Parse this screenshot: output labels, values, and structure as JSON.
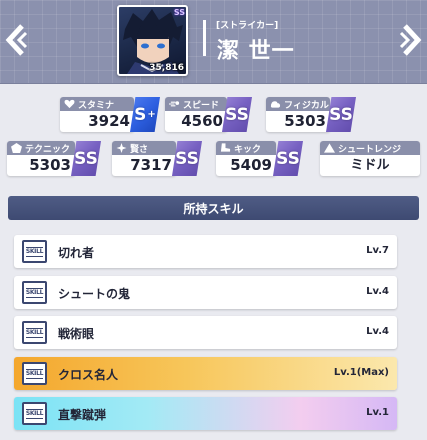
{
  "header": {
    "role": "[ストライカー]",
    "name": "潔 世一",
    "power": "35,816",
    "stamp": "SS"
  },
  "stats": [
    {
      "key": "stamina",
      "label": "スタミナ",
      "value": "3924",
      "rank": "S",
      "rank_plus": "+",
      "icon": "heart-icon"
    },
    {
      "key": "speed",
      "label": "スピード",
      "value": "4560",
      "rank": "SS",
      "icon": "speed-icon"
    },
    {
      "key": "physical",
      "label": "フィジカル",
      "value": "5303",
      "rank": "SS",
      "icon": "muscle-icon"
    },
    {
      "key": "technique",
      "label": "テクニック",
      "value": "5303",
      "rank": "SS",
      "icon": "pentagon-icon"
    },
    {
      "key": "wisdom",
      "label": "賢さ",
      "value": "7317",
      "rank": "SS",
      "icon": "sparkle-icon"
    },
    {
      "key": "kick",
      "label": "キック",
      "value": "5409",
      "rank": "SS",
      "icon": "boot-icon"
    }
  ],
  "shoot_range": {
    "label": "シュートレンジ",
    "value": "ミドル",
    "icon": "triangle-icon"
  },
  "skills_section": {
    "title": "所持スキル",
    "icon_text": "SKILL",
    "items": [
      {
        "name": "切れ者",
        "level": "Lv.7",
        "style": "normal"
      },
      {
        "name": "シュートの鬼",
        "level": "Lv.4",
        "style": "normal"
      },
      {
        "name": "戦術眼",
        "level": "Lv.4",
        "style": "normal"
      },
      {
        "name": "クロス名人",
        "level": "Lv.1(Max)",
        "style": "gold"
      },
      {
        "name": "直撃蹴弾",
        "level": "Lv.1",
        "style": "rainbow"
      }
    ]
  },
  "colors": {
    "header_bg": "#8b91ae",
    "rank_s_plus": "#2d5fe0",
    "rank_ss": "#7761c2",
    "section_header": "#4f5c85",
    "gold_skill": "#f4a72d",
    "rainbow_skill": "#7be3f5"
  }
}
